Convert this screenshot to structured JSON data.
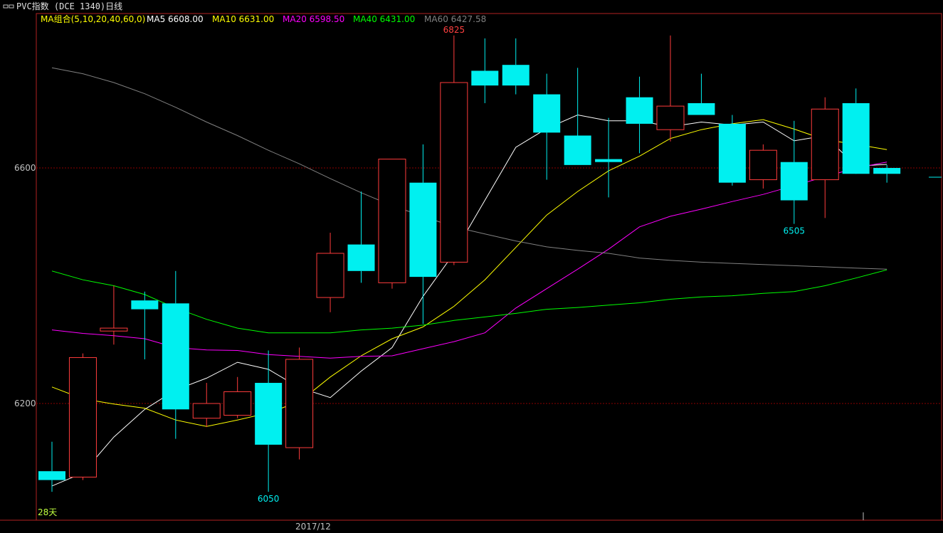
{
  "window": {
    "title": "PVC指数 (DCE 1340)日线",
    "icon": "window-restore-icon"
  },
  "legend": {
    "group_label": "MA组合(5,10,20,40,60,0)",
    "items": [
      {
        "label": "MA5 6608.00",
        "color": "#ffffff"
      },
      {
        "label": "MA10 6631.00",
        "color": "#ffff00"
      },
      {
        "label": "MA20 6598.50",
        "color": "#ff00ff"
      },
      {
        "label": "MA40 6431.00",
        "color": "#00ff00"
      },
      {
        "label": "MA60 6427.58",
        "color": "#808080"
      }
    ]
  },
  "colors": {
    "background": "#000000",
    "frame": "#b22222",
    "gridline": "#8b0000",
    "up": "#ff3c3c",
    "down": "#00f0f0",
    "axis_text": "#c0c0c0",
    "group_label": "#ffff00"
  },
  "chart_data": {
    "type": "candlestick",
    "y_ticks": [
      "6600",
      "6200"
    ],
    "x_tick_label": "2017/12",
    "high_label": "6825",
    "low_labels": [
      "6050",
      "6505"
    ],
    "days_label": "28天",
    "ylim": [
      5980,
      6870
    ],
    "candles": [
      {
        "o": 6085,
        "h": 6135,
        "l": 6050,
        "c": 6070
      },
      {
        "o": 6075,
        "h": 6285,
        "l": 6070,
        "c": 6278
      },
      {
        "o": 6323,
        "h": 6400,
        "l": 6300,
        "c": 6328
      },
      {
        "o": 6375,
        "h": 6390,
        "l": 6275,
        "c": 6360
      },
      {
        "o": 6370,
        "h": 6425,
        "l": 6140,
        "c": 6190
      },
      {
        "o": 6175,
        "h": 6235,
        "l": 6160,
        "c": 6200
      },
      {
        "o": 6180,
        "h": 6245,
        "l": 6175,
        "c": 6220
      },
      {
        "o": 6235,
        "h": 6290,
        "l": 6050,
        "c": 6130
      },
      {
        "o": 6125,
        "h": 6295,
        "l": 6105,
        "c": 6275
      },
      {
        "o": 6380,
        "h": 6490,
        "l": 6355,
        "c": 6455
      },
      {
        "o": 6470,
        "h": 6560,
        "l": 6405,
        "c": 6425
      },
      {
        "o": 6405,
        "h": 6615,
        "l": 6395,
        "c": 6615
      },
      {
        "o": 6575,
        "h": 6640,
        "l": 6335,
        "c": 6415
      },
      {
        "o": 6440,
        "h": 6825,
        "l": 6435,
        "c": 6745
      },
      {
        "o": 6765,
        "h": 6820,
        "l": 6710,
        "c": 6740
      },
      {
        "o": 6775,
        "h": 6820,
        "l": 6725,
        "c": 6740
      },
      {
        "o": 6725,
        "h": 6760,
        "l": 6580,
        "c": 6660
      },
      {
        "o": 6655,
        "h": 6770,
        "l": 6605,
        "c": 6605
      },
      {
        "o": 6615,
        "h": 6685,
        "l": 6550,
        "c": 6610
      },
      {
        "o": 6720,
        "h": 6755,
        "l": 6625,
        "c": 6675
      },
      {
        "o": 6665,
        "h": 6825,
        "l": 6645,
        "c": 6705
      },
      {
        "o": 6710,
        "h": 6760,
        "l": 6695,
        "c": 6690
      },
      {
        "o": 6675,
        "h": 6690,
        "l": 6570,
        "c": 6575
      },
      {
        "o": 6580,
        "h": 6640,
        "l": 6565,
        "c": 6630
      },
      {
        "o": 6610,
        "h": 6680,
        "l": 6505,
        "c": 6545
      },
      {
        "o": 6580,
        "h": 6720,
        "l": 6515,
        "c": 6700
      },
      {
        "o": 6710,
        "h": 6735,
        "l": 6595,
        "c": 6590
      },
      {
        "o": 6600,
        "h": 6605,
        "l": 6575,
        "c": 6590
      }
    ],
    "series": [
      {
        "name": "MA5",
        "color": "#ffffff",
        "values": [
          6060,
          6082,
          6143,
          6190,
          6223,
          6243,
          6270,
          6258,
          6227,
          6210,
          6255,
          6295,
          6382,
          6455,
          6545,
          6635,
          6667,
          6690,
          6680,
          6680,
          6670,
          6678,
          6673,
          6678,
          6646,
          6655,
          6603,
          6606
        ]
      },
      {
        "name": "MA10",
        "color": "#ffff00",
        "values": [
          6228,
          6208,
          6199,
          6192,
          6172,
          6161,
          6172,
          6184,
          6203,
          6245,
          6281,
          6310,
          6330,
          6365,
          6410,
          6465,
          6520,
          6560,
          6595,
          6620,
          6650,
          6665,
          6675,
          6682,
          6666,
          6648,
          6640,
          6631
        ]
      },
      {
        "name": "MA20",
        "color": "#ff00ff",
        "values": [
          6325,
          6319,
          6315,
          6310,
          6295,
          6291,
          6290,
          6283,
          6280,
          6277,
          6280,
          6281,
          6293,
          6305,
          6320,
          6362,
          6395,
          6428,
          6462,
          6500,
          6518,
          6530,
          6543,
          6555,
          6570,
          6585,
          6600,
          6610
        ]
      },
      {
        "name": "MA40",
        "color": "#00ff00",
        "values": [
          6425,
          6410,
          6400,
          6385,
          6362,
          6343,
          6328,
          6320,
          6320,
          6320,
          6325,
          6328,
          6333,
          6341,
          6347,
          6353,
          6360,
          6363,
          6367,
          6371,
          6377,
          6381,
          6383,
          6387,
          6390,
          6400,
          6413,
          6427
        ]
      },
      {
        "name": "MA60",
        "color": "#808080",
        "values": [
          6770,
          6760,
          6745,
          6726,
          6703,
          6678,
          6655,
          6630,
          6607,
          6582,
          6558,
          6536,
          6518,
          6500,
          6488,
          6476,
          6466,
          6460,
          6455,
          6447,
          6443,
          6440,
          6438,
          6436,
          6434,
          6432,
          6430,
          6428
        ]
      }
    ]
  }
}
